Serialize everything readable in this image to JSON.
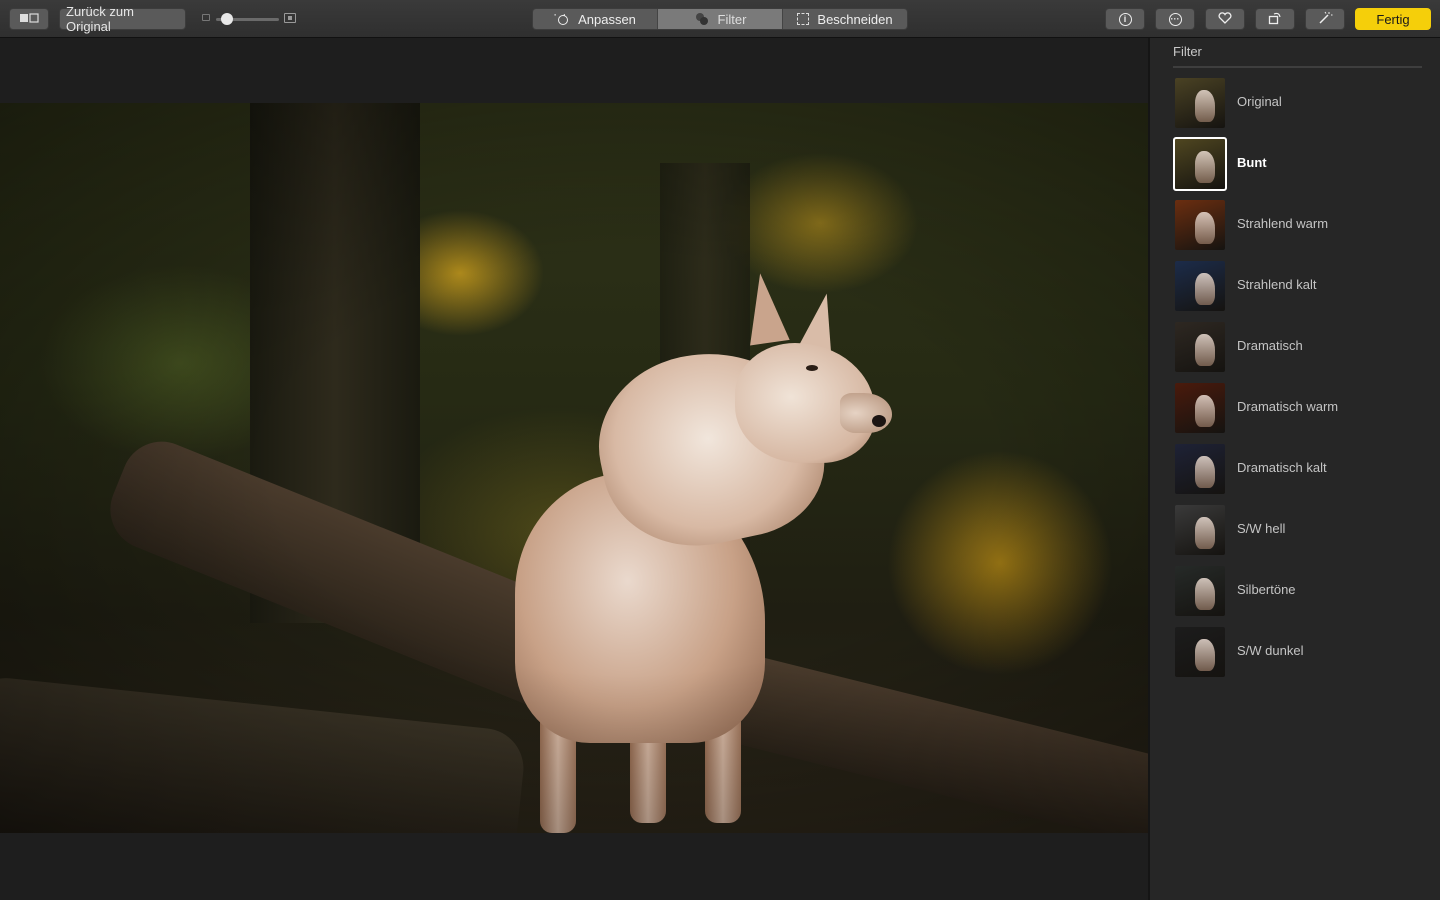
{
  "toolbar": {
    "compare_icon": "compare-split-icon",
    "revert_label": "Zurück zum Original",
    "zoom_level": 0.1,
    "tabs": [
      {
        "label": "Anpassen",
        "icon": "adjust-sun-icon",
        "active": false
      },
      {
        "label": "Filter",
        "icon": "filter-circles-icon",
        "active": true
      },
      {
        "label": "Beschneiden",
        "icon": "crop-icon",
        "active": false
      }
    ],
    "info_icon": "info-icon",
    "more_icon": "more-ellipsis-icon",
    "favorite_icon": "heart-icon",
    "rotate_icon": "rotate-icon",
    "enhance_icon": "magic-wand-icon",
    "done_label": "Fertig",
    "done_color": "#f5cf0a"
  },
  "sidebar": {
    "title": "Filter",
    "filters": [
      {
        "label": "Original",
        "tint": "#4a4224",
        "selected": false
      },
      {
        "label": "Bunt",
        "tint": "#4f4620",
        "selected": true
      },
      {
        "label": "Strahlend warm",
        "tint": "#6b2e10",
        "selected": false
      },
      {
        "label": "Strahlend kalt",
        "tint": "#1c2c4a",
        "selected": false
      },
      {
        "label": "Dramatisch",
        "tint": "#2e2822",
        "selected": false
      },
      {
        "label": "Dramatisch warm",
        "tint": "#4a1a0c",
        "selected": false
      },
      {
        "label": "Dramatisch kalt",
        "tint": "#1e2236",
        "selected": false
      },
      {
        "label": "S/W hell",
        "tint": "#3a3a3a",
        "selected": false
      },
      {
        "label": "Silbertöne",
        "tint": "#262a28",
        "selected": false
      },
      {
        "label": "S/W dunkel",
        "tint": "#1c1c1c",
        "selected": false
      }
    ]
  }
}
